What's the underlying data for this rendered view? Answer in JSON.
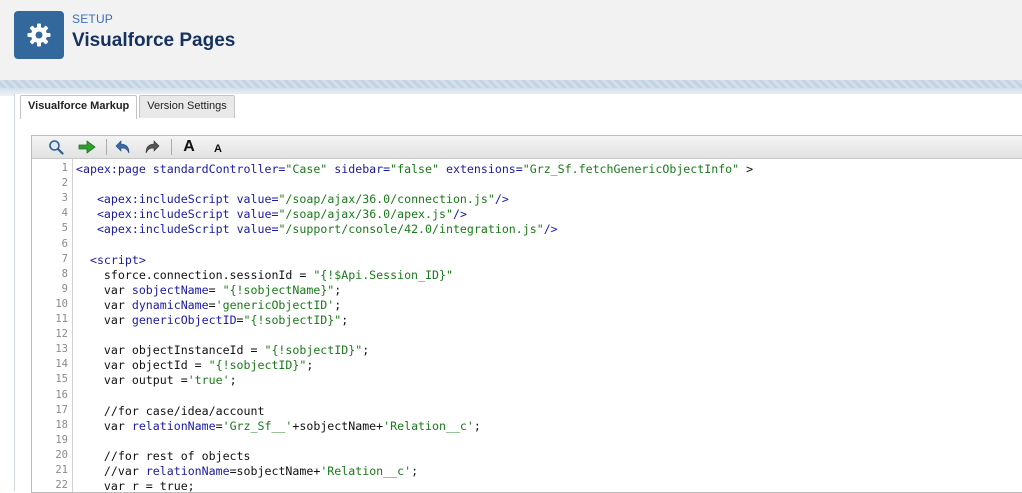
{
  "header": {
    "setup_label": "SETUP",
    "title": "Visualforce Pages",
    "icon": "gear-icon"
  },
  "tabs": [
    {
      "label": "Visualforce Markup",
      "active": true
    },
    {
      "label": "Version Settings",
      "active": false
    }
  ],
  "toolbar": {
    "items": [
      "search-icon",
      "goto-line-icon",
      "undo-icon",
      "redo-icon",
      "font-increase-icon",
      "font-decrease-icon"
    ],
    "font_increase_label": "A",
    "font_decrease_label": "A"
  },
  "code": {
    "lines": [
      {
        "n": "1",
        "parts": [
          [
            "tag",
            "<apex:page "
          ],
          [
            "attr",
            "standardController="
          ],
          [
            "str",
            "\"Case\""
          ],
          [
            "plain",
            " "
          ],
          [
            "attr",
            "sidebar="
          ],
          [
            "str",
            "\"false\""
          ],
          [
            "plain",
            " "
          ],
          [
            "attr",
            "extensions="
          ],
          [
            "str",
            "\"Grz_Sf.fetchGenericObjectInfo\""
          ],
          [
            "plain",
            " >"
          ]
        ]
      },
      {
        "n": "2",
        "parts": []
      },
      {
        "n": "3",
        "parts": [
          [
            "plain",
            "   "
          ],
          [
            "tag",
            "<apex:includeScript "
          ],
          [
            "attr",
            "value="
          ],
          [
            "str",
            "\"/soap/ajax/36.0/connection.js\""
          ],
          [
            "tag",
            "/>"
          ]
        ]
      },
      {
        "n": "4",
        "parts": [
          [
            "plain",
            "   "
          ],
          [
            "tag",
            "<apex:includeScript "
          ],
          [
            "attr",
            "value="
          ],
          [
            "str",
            "\"/soap/ajax/36.0/apex.js\""
          ],
          [
            "tag",
            "/>"
          ]
        ]
      },
      {
        "n": "5",
        "parts": [
          [
            "plain",
            "   "
          ],
          [
            "tag",
            "<apex:includeScript "
          ],
          [
            "attr",
            "value="
          ],
          [
            "str",
            "\"/support/console/42.0/integration.js\""
          ],
          [
            "tag",
            "/>"
          ]
        ]
      },
      {
        "n": "6",
        "parts": []
      },
      {
        "n": "7",
        "parts": [
          [
            "plain",
            "  "
          ],
          [
            "tag",
            "<script>"
          ]
        ]
      },
      {
        "n": "8",
        "parts": [
          [
            "plain",
            "    sforce.connection.sessionId = "
          ],
          [
            "str",
            "\"{!$Api.Session_ID}\""
          ]
        ]
      },
      {
        "n": "9",
        "parts": [
          [
            "plain",
            "    var "
          ],
          [
            "var",
            "sobjectName"
          ],
          [
            "plain",
            "= "
          ],
          [
            "str",
            "\"{!sobjectName}\""
          ],
          [
            "plain",
            ";"
          ]
        ]
      },
      {
        "n": "10",
        "parts": [
          [
            "plain",
            "    var "
          ],
          [
            "var",
            "dynamicName"
          ],
          [
            "plain",
            "="
          ],
          [
            "str",
            "'genericObjectID'"
          ],
          [
            "plain",
            ";"
          ]
        ]
      },
      {
        "n": "11",
        "parts": [
          [
            "plain",
            "    var "
          ],
          [
            "var",
            "genericObjectID"
          ],
          [
            "plain",
            "="
          ],
          [
            "str",
            "\"{!sobjectID}\""
          ],
          [
            "plain",
            ";"
          ]
        ]
      },
      {
        "n": "12",
        "parts": []
      },
      {
        "n": "13",
        "parts": [
          [
            "plain",
            "    var objectInstanceId = "
          ],
          [
            "str",
            "\"{!sobjectID}\""
          ],
          [
            "plain",
            ";"
          ]
        ]
      },
      {
        "n": "14",
        "parts": [
          [
            "plain",
            "    var objectId = "
          ],
          [
            "str",
            "\"{!sobjectID}\""
          ],
          [
            "plain",
            ";"
          ]
        ]
      },
      {
        "n": "15",
        "parts": [
          [
            "plain",
            "    var output ="
          ],
          [
            "str",
            "'true'"
          ],
          [
            "plain",
            ";"
          ]
        ]
      },
      {
        "n": "16",
        "parts": []
      },
      {
        "n": "17",
        "parts": [
          [
            "plain",
            "    //for case/idea/account"
          ]
        ]
      },
      {
        "n": "18",
        "parts": [
          [
            "plain",
            "    var "
          ],
          [
            "var",
            "relationName"
          ],
          [
            "plain",
            "="
          ],
          [
            "str",
            "'Grz_Sf__'"
          ],
          [
            "plain",
            "+sobjectName+"
          ],
          [
            "str",
            "'Relation__c'"
          ],
          [
            "plain",
            ";"
          ]
        ]
      },
      {
        "n": "19",
        "parts": []
      },
      {
        "n": "20",
        "parts": [
          [
            "plain",
            "    //for rest of objects"
          ]
        ]
      },
      {
        "n": "21",
        "parts": [
          [
            "plain",
            "    //var "
          ],
          [
            "var",
            "relationName"
          ],
          [
            "plain",
            "=sobjectName+"
          ],
          [
            "str",
            "'Relation__c'"
          ],
          [
            "plain",
            ";"
          ]
        ]
      },
      {
        "n": "22",
        "parts": [
          [
            "plain",
            "    var r = true;"
          ]
        ]
      }
    ]
  }
}
